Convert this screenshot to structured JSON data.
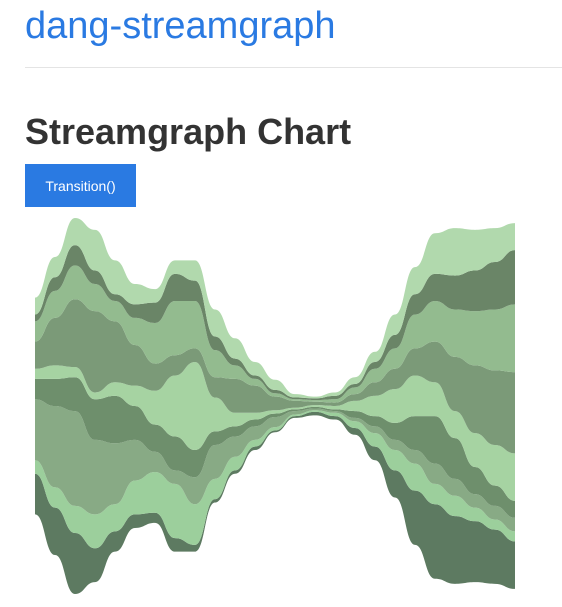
{
  "header": {
    "site_title": "dang-streamgraph"
  },
  "main": {
    "heading": "Streamgraph Chart",
    "button_label": "Transition()"
  },
  "chart_data": {
    "type": "area",
    "offset": "silhouette",
    "layer_count": 9,
    "sample_count": 25,
    "colors": [
      "#5d7a61",
      "#9ccf9c",
      "#88aa85",
      "#6e8f6c",
      "#a6d3a2",
      "#7b9a78",
      "#93bb8f",
      "#6a8567",
      "#b1d9ad"
    ],
    "series": [
      {
        "values": [
          12,
          14,
          18,
          10,
          6,
          4,
          3,
          4,
          2,
          1,
          1,
          1,
          0.5,
          0.5,
          1,
          1,
          2,
          4,
          8,
          16,
          22,
          20,
          18,
          16,
          14
        ]
      },
      {
        "values": [
          4,
          6,
          8,
          10,
          8,
          10,
          12,
          16,
          12,
          6,
          4,
          2,
          1,
          0.5,
          0.5,
          1,
          2,
          4,
          6,
          8,
          6,
          6,
          4,
          3,
          3
        ]
      },
      {
        "values": [
          18,
          24,
          28,
          22,
          18,
          12,
          6,
          4,
          8,
          10,
          6,
          4,
          3,
          1,
          0.5,
          0.5,
          1,
          2,
          3,
          4,
          6,
          5,
          4,
          4,
          4
        ]
      },
      {
        "values": [
          6,
          8,
          10,
          12,
          14,
          10,
          8,
          10,
          8,
          4,
          3,
          2,
          1,
          0.5,
          0.5,
          0.5,
          2,
          3,
          5,
          10,
          14,
          12,
          8,
          6,
          5
        ]
      },
      {
        "values": [
          3,
          4,
          3,
          2,
          4,
          6,
          10,
          18,
          26,
          10,
          4,
          2,
          1,
          0.5,
          0.5,
          1,
          3,
          6,
          10,
          12,
          10,
          8,
          10,
          12,
          14
        ]
      },
      {
        "values": [
          8,
          14,
          20,
          24,
          18,
          12,
          8,
          6,
          4,
          6,
          10,
          8,
          4,
          2,
          1,
          1,
          2,
          4,
          6,
          8,
          12,
          16,
          20,
          22,
          24
        ]
      },
      {
        "values": [
          6,
          8,
          10,
          8,
          6,
          8,
          12,
          16,
          14,
          8,
          4,
          2,
          1,
          0.5,
          0.5,
          1,
          2,
          4,
          6,
          10,
          12,
          14,
          16,
          18,
          20
        ]
      },
      {
        "values": [
          2,
          4,
          6,
          4,
          2,
          4,
          6,
          8,
          6,
          4,
          2,
          1,
          1,
          0.5,
          0.5,
          1,
          1,
          2,
          4,
          6,
          8,
          10,
          12,
          14,
          16
        ]
      },
      {
        "values": [
          5,
          6,
          8,
          12,
          10,
          6,
          4,
          4,
          6,
          8,
          6,
          4,
          3,
          1,
          0.5,
          1,
          2,
          3,
          6,
          8,
          12,
          14,
          12,
          10,
          8
        ]
      }
    ]
  }
}
